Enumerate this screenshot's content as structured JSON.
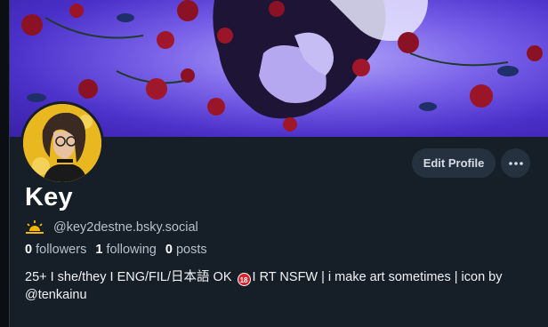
{
  "profile": {
    "display_name": "Key",
    "handle": "@key2destne.bsky.social",
    "handle_icon": "sun-behind-horizon-icon",
    "stats": {
      "followers_count": "0",
      "followers_label": "followers",
      "following_count": "1",
      "following_label": "following",
      "posts_count": "0",
      "posts_label": "posts"
    },
    "bio_part1": "25+ I she/they I ENG/FIL/日本語 OK ",
    "bio_badge": "18",
    "bio_part2": "I RT NSFW | i make art sometimes | icon by @tenkainu"
  },
  "actions": {
    "edit_profile_label": "Edit Profile",
    "more_icon": "ellipsis-icon"
  },
  "colors": {
    "panel": "#161e27",
    "button": "#263140",
    "banner_purple": "#6f56e6",
    "avatar_yellow": "#e9b820"
  }
}
